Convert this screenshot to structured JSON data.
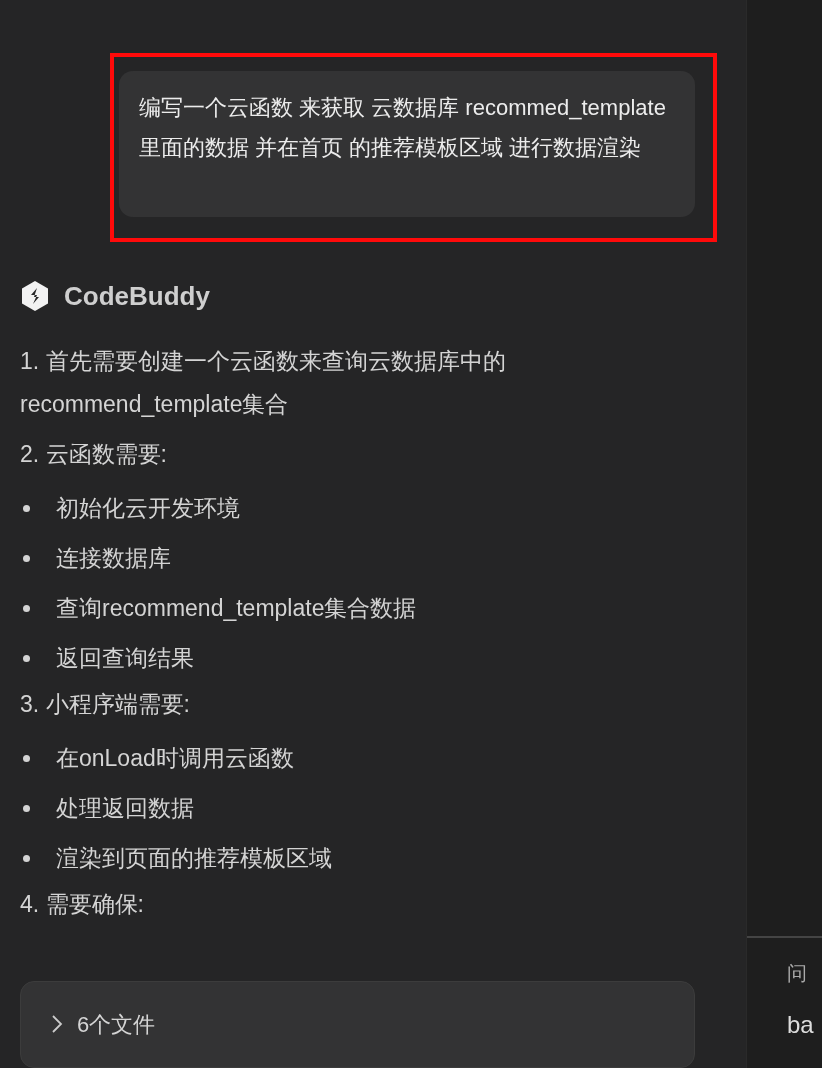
{
  "user_message": {
    "text": "编写一个云函数 来获取 云数据库 recommed_template 里面的数据  并在首页 的推荐模板区域 进行数据渲染",
    "highlighted": true
  },
  "assistant": {
    "name": "CodeBuddy",
    "items": [
      {
        "kind": "numbered",
        "text": "1. 首先需要创建一个云函数来查询云数据库中的recommend_template集合"
      },
      {
        "kind": "numbered",
        "text": "2. 云函数需要:"
      },
      {
        "kind": "bullet",
        "text": "初始化云开发环境"
      },
      {
        "kind": "bullet",
        "text": "连接数据库"
      },
      {
        "kind": "bullet",
        "text": "查询recommend_template集合数据"
      },
      {
        "kind": "bullet",
        "text": "返回查询结果"
      },
      {
        "kind": "numbered",
        "text": "3. 小程序端需要:"
      },
      {
        "kind": "bullet",
        "text": "在onLoad时调用云函数"
      },
      {
        "kind": "bullet",
        "text": "处理返回数据"
      },
      {
        "kind": "bullet",
        "text": "渲染到页面的推荐模板区域"
      },
      {
        "kind": "numbered",
        "text": "4. 需要确保:"
      }
    ]
  },
  "files": {
    "label": "6个文件",
    "expanded": false
  },
  "panel": {
    "tab": "问",
    "row": "ba"
  }
}
